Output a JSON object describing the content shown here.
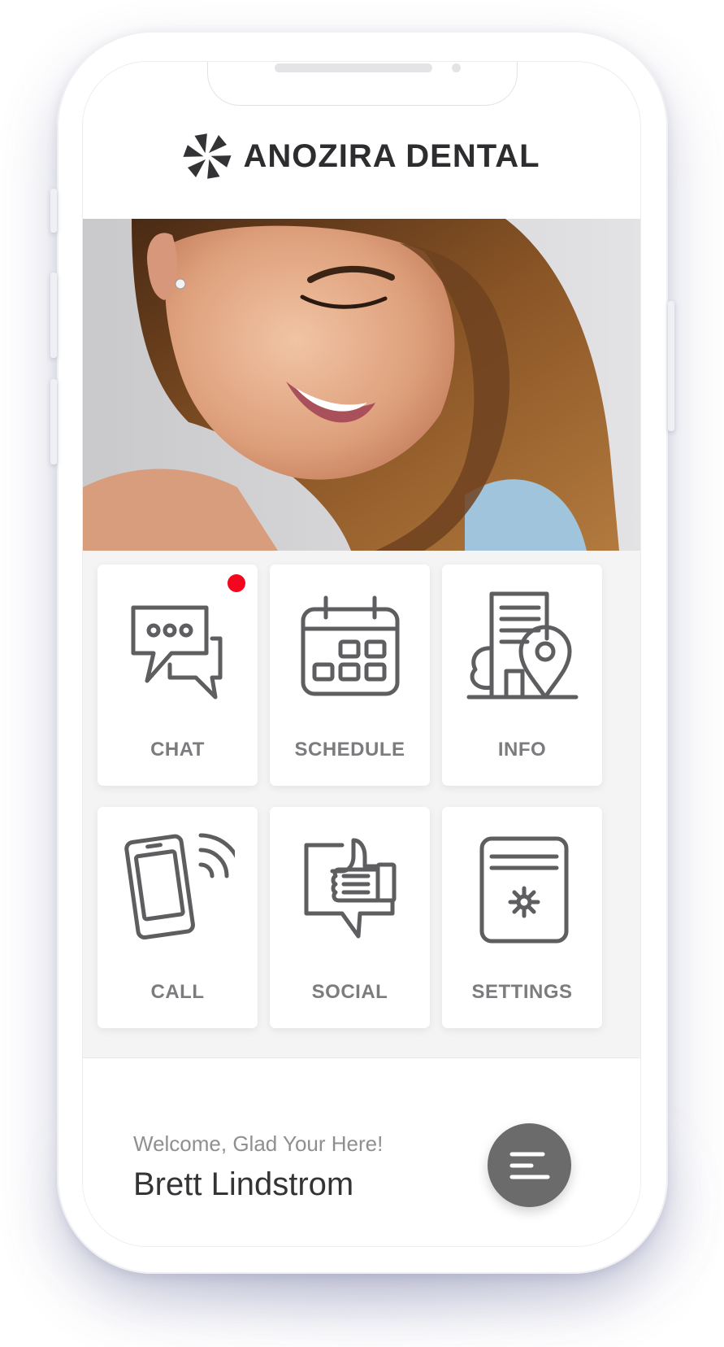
{
  "app": {
    "brand_name": "ANOZIRA DENTAL",
    "logo_icon": "pinwheel-logo",
    "hero_image": "smiling-woman-photo"
  },
  "tiles": [
    {
      "label": "CHAT",
      "icon": "chat-bubbles-icon",
      "has_notification": true
    },
    {
      "label": "SCHEDULE",
      "icon": "calendar-icon"
    },
    {
      "label": "INFO",
      "icon": "building-location-icon"
    },
    {
      "label": "CALL",
      "icon": "phone-call-icon"
    },
    {
      "label": "SOCIAL",
      "icon": "thumbs-up-icon"
    },
    {
      "label": "SETTINGS",
      "icon": "settings-card-icon"
    }
  ],
  "footer": {
    "greeting": "Welcome, Glad Your Here!",
    "user_name": "Brett Lindstrom",
    "menu_icon": "menu-icon"
  },
  "colors": {
    "brand_text": "#2d2d30",
    "icon_stroke": "#5e5e61",
    "label_text": "#7c7c7f",
    "notification_dot": "#f4061f",
    "menu_button": "#6b6b6b",
    "grid_background": "#f4f4f5"
  }
}
